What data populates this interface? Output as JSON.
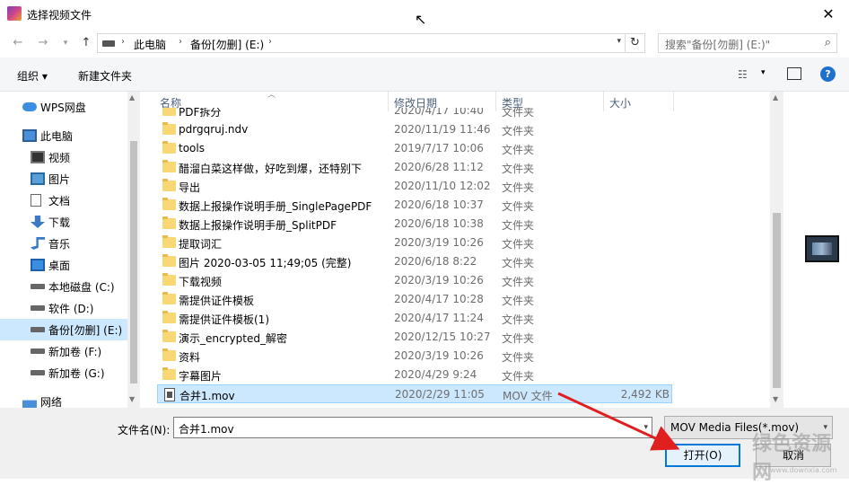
{
  "window": {
    "title": "选择视频文件",
    "close_glyph": "✕"
  },
  "address": {
    "segments": [
      "此电脑",
      "备份[勿删] (E:)"
    ],
    "search_placeholder": "搜索\"备份[勿删] (E:)\""
  },
  "toolbar": {
    "organize": "组织 ▾",
    "new_folder": "新建文件夹"
  },
  "nav": [
    {
      "label": "WPS网盘",
      "icon": "cloud-icon",
      "level": 0
    },
    {
      "label": "此电脑",
      "icon": "computer-icon",
      "level": 0
    },
    {
      "label": "视频",
      "icon": "video-folder-icon",
      "level": 1
    },
    {
      "label": "图片",
      "icon": "pictures-folder-icon",
      "level": 1
    },
    {
      "label": "文档",
      "icon": "documents-folder-icon",
      "level": 1
    },
    {
      "label": "下载",
      "icon": "download-icon",
      "level": 1
    },
    {
      "label": "音乐",
      "icon": "music-icon",
      "level": 1
    },
    {
      "label": "桌面",
      "icon": "desktop-icon",
      "level": 1
    },
    {
      "label": "本地磁盘 (C:)",
      "icon": "drive-icon",
      "level": 1
    },
    {
      "label": "软件 (D:)",
      "icon": "drive-icon",
      "level": 1
    },
    {
      "label": "备份[勿删] (E:)",
      "icon": "drive-icon",
      "level": 1,
      "selected": true
    },
    {
      "label": "新加卷 (F:)",
      "icon": "drive-icon",
      "level": 1
    },
    {
      "label": "新加卷 (G:)",
      "icon": "drive-icon",
      "level": 1
    },
    {
      "label": "网络",
      "icon": "network-icon",
      "level": 0
    }
  ],
  "columns": {
    "name": "名称",
    "date": "修改日期",
    "type": "类型",
    "size": "大小"
  },
  "files": [
    {
      "name": "PDF拆分",
      "date": "2020/4/17 10:40",
      "type": "文件夹",
      "size": "",
      "kind": "folder"
    },
    {
      "name": "pdrgqruj.ndv",
      "date": "2020/11/19 11:46",
      "type": "文件夹",
      "size": "",
      "kind": "folder"
    },
    {
      "name": "tools",
      "date": "2019/7/17 10:06",
      "type": "文件夹",
      "size": "",
      "kind": "folder"
    },
    {
      "name": "醋溜白菜这样做，好吃到爆，还特别下",
      "date": "2020/6/28 11:12",
      "type": "文件夹",
      "size": "",
      "kind": "folder"
    },
    {
      "name": "导出",
      "date": "2020/11/10 12:02",
      "type": "文件夹",
      "size": "",
      "kind": "folder"
    },
    {
      "name": "数据上报操作说明手册_SinglePagePDF",
      "date": "2020/6/18 10:37",
      "type": "文件夹",
      "size": "",
      "kind": "folder"
    },
    {
      "name": "数据上报操作说明手册_SplitPDF",
      "date": "2020/6/18 10:38",
      "type": "文件夹",
      "size": "",
      "kind": "folder"
    },
    {
      "name": "提取词汇",
      "date": "2020/3/19 10:26",
      "type": "文件夹",
      "size": "",
      "kind": "folder"
    },
    {
      "name": "图片 2020-03-05 11;49;05 (完整)",
      "date": "2020/6/18 8:22",
      "type": "文件夹",
      "size": "",
      "kind": "folder"
    },
    {
      "name": "下载视频",
      "date": "2020/3/19 10:26",
      "type": "文件夹",
      "size": "",
      "kind": "folder"
    },
    {
      "name": "需提供证件模板",
      "date": "2020/4/17 10:28",
      "type": "文件夹",
      "size": "",
      "kind": "folder"
    },
    {
      "name": "需提供证件模板(1)",
      "date": "2020/4/17 11:24",
      "type": "文件夹",
      "size": "",
      "kind": "folder"
    },
    {
      "name": "演示_encrypted_解密",
      "date": "2020/12/15 10:27",
      "type": "文件夹",
      "size": "",
      "kind": "folder"
    },
    {
      "name": "资料",
      "date": "2020/3/19 10:26",
      "type": "文件夹",
      "size": "",
      "kind": "folder"
    },
    {
      "name": "字幕图片",
      "date": "2020/4/29 9:24",
      "type": "文件夹",
      "size": "",
      "kind": "folder"
    },
    {
      "name": "合并1.mov",
      "date": "2020/2/29 11:05",
      "type": "MOV 文件",
      "size": "2,492 KB",
      "kind": "mov",
      "selected": true
    }
  ],
  "bottom": {
    "filename_label": "文件名(N):",
    "filename_value": "合并1.mov",
    "filter_value": "MOV Media Files(*.mov)",
    "open_label": "打开(O)",
    "cancel_label": "取消"
  },
  "colors": {
    "selection": "#cce8ff",
    "accent": "#0078d7",
    "arrow": "#e02020"
  },
  "watermark": {
    "text": "绿色资源网",
    "url": "www.downxia.com"
  }
}
